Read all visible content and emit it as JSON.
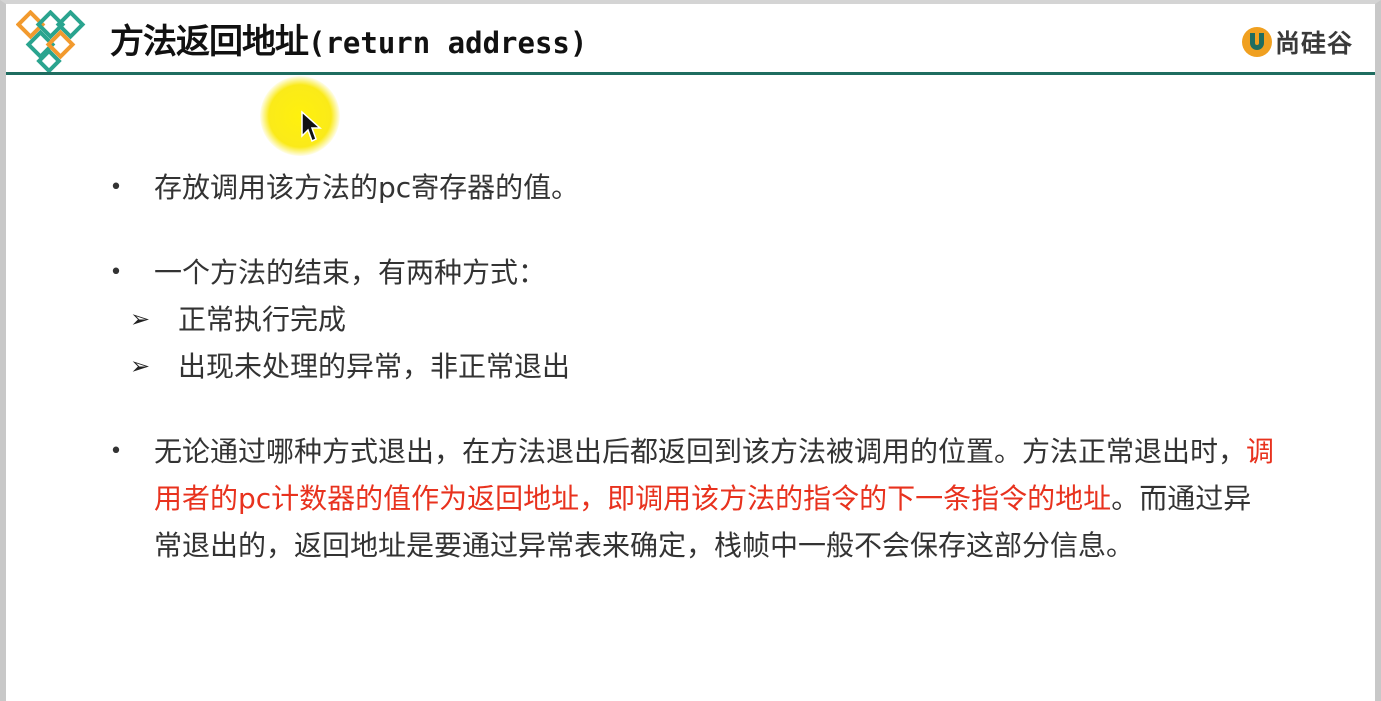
{
  "header": {
    "title_cn": "方法返回地址",
    "title_en": "(return address)",
    "brand_text": "尚硅谷",
    "logo_icon": "diamond-lattice-logo",
    "brand_icon": "u-badge-logo"
  },
  "colors": {
    "rule": "#1f6d60",
    "accent_red": "#e8321e",
    "highlight": "#f5e600"
  },
  "content": {
    "bullet1": "存放调用该方法的pc寄存器的值。",
    "bullet2": {
      "text": "一个方法的结束，有两种方式：",
      "subs": [
        "正常执行完成",
        "出现未处理的异常，非正常退出"
      ]
    },
    "bullet3": {
      "part1": "无论通过哪种方式退出，在方法退出后都返回到该方法被调用的位置。方法正常退出时，",
      "part2_red": "调用者的pc计数器的值作为返回地址，即调用该方法的指令的下一条指令的地址",
      "part3": "。而通过异常退出的，返回地址是要通过异常表来确定，栈帧中一般不会保存这部分信息。"
    }
  }
}
